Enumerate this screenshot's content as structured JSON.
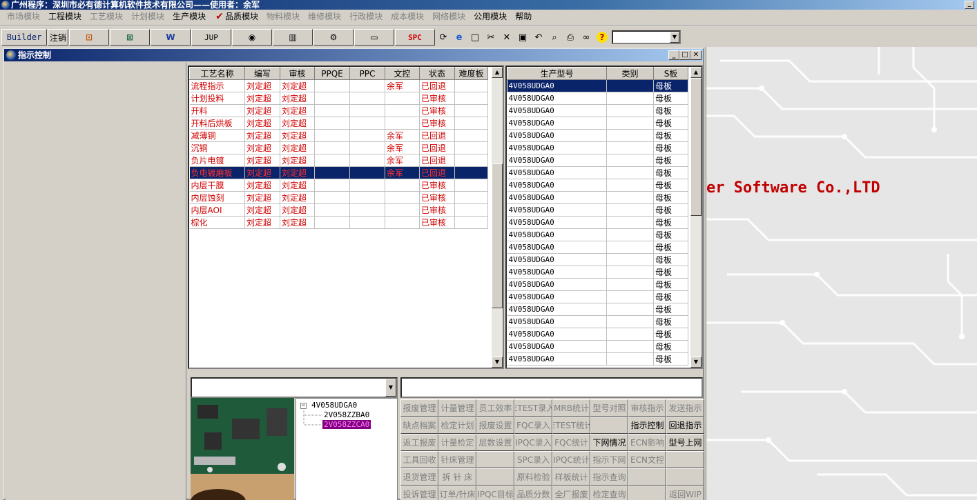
{
  "app": {
    "title": "广州程序：深圳市必有德计算机软件技术有限公司——使用者：余军"
  },
  "menu": [
    {
      "label": "市场模块",
      "enabled": false
    },
    {
      "label": "工程模块",
      "enabled": true
    },
    {
      "label": "工艺模块",
      "enabled": false
    },
    {
      "label": "计划模块",
      "enabled": false
    },
    {
      "label": "生产模块",
      "enabled": true
    },
    {
      "label": "品质模块",
      "enabled": true,
      "checked": true
    },
    {
      "label": "物料模块",
      "enabled": false
    },
    {
      "label": "维修模块",
      "enabled": false
    },
    {
      "label": "行政模块",
      "enabled": false
    },
    {
      "label": "成本模块",
      "enabled": false
    },
    {
      "label": "网络模块",
      "enabled": false
    },
    {
      "label": "公用模块",
      "enabled": true
    },
    {
      "label": "帮助",
      "enabled": true
    }
  ],
  "toolbar": {
    "builder": "Builder",
    "logout": "注销",
    "jup": "JUP",
    "spc": "SPC"
  },
  "desktop": {
    "splash": "er Software Co.,LTD"
  },
  "child": {
    "title": "指示控制"
  },
  "process_grid": {
    "columns": [
      "工艺名称",
      "编写",
      "审核",
      "PPQE",
      "PPC",
      "文控",
      "状态",
      "难度板"
    ],
    "rows": [
      [
        "流程指示",
        "刘定超",
        "刘定超",
        "",
        "",
        "余军",
        "已回退",
        ""
      ],
      [
        "计划投料",
        "刘定超",
        "刘定超",
        "",
        "",
        "",
        "已审核",
        ""
      ],
      [
        "开料",
        "刘定超",
        "刘定超",
        "",
        "",
        "",
        "已审核",
        ""
      ],
      [
        "开料后烘板",
        "刘定超",
        "刘定超",
        "",
        "",
        "",
        "已审核",
        ""
      ],
      [
        "减薄铜",
        "刘定超",
        "刘定超",
        "",
        "",
        "余军",
        "已回退",
        ""
      ],
      [
        "沉铜",
        "刘定超",
        "刘定超",
        "",
        "",
        "余军",
        "已回退",
        ""
      ],
      [
        "负片电镀",
        "刘定超",
        "刘定超",
        "",
        "",
        "余军",
        "已回退",
        ""
      ],
      [
        "负电镀磨板",
        "刘定超",
        "刘定超",
        "",
        "",
        "余军",
        "已回退",
        ""
      ],
      [
        "内层干膜",
        "刘定超",
        "刘定超",
        "",
        "",
        "",
        "已审核",
        ""
      ],
      [
        "内层蚀刻",
        "刘定超",
        "刘定超",
        "",
        "",
        "",
        "已审核",
        ""
      ],
      [
        "内层AOI",
        "刘定超",
        "刘定超",
        "",
        "",
        "",
        "已审核",
        ""
      ],
      [
        "棕化",
        "刘定超",
        "刘定超",
        "",
        "",
        "",
        "已审核",
        ""
      ]
    ],
    "selected_row": 7
  },
  "model_grid": {
    "columns": [
      "生产型号",
      "类别",
      "S板"
    ],
    "rows": [
      [
        "4V058UDGA0",
        "",
        "母板"
      ],
      [
        "4V058UDGA0",
        "",
        "母板"
      ],
      [
        "4V058UDGA0",
        "",
        "母板"
      ],
      [
        "4V058UDGA0",
        "",
        "母板"
      ],
      [
        "4V058UDGA0",
        "",
        "母板"
      ],
      [
        "4V058UDGA0",
        "",
        "母板"
      ],
      [
        "4V058UDGA0",
        "",
        "母板"
      ],
      [
        "4V058UDGA0",
        "",
        "母板"
      ],
      [
        "4V058UDGA0",
        "",
        "母板"
      ],
      [
        "4V058UDGA0",
        "",
        "母板"
      ],
      [
        "4V058UDGA0",
        "",
        "母板"
      ],
      [
        "4V058UDGA0",
        "",
        "母板"
      ],
      [
        "4V058UDGA0",
        "",
        "母板"
      ],
      [
        "4V058UDGA0",
        "",
        "母板"
      ],
      [
        "4V058UDGA0",
        "",
        "母板"
      ],
      [
        "4V058UDGA0",
        "",
        "母板"
      ],
      [
        "4V058UDGA0",
        "",
        "母板"
      ],
      [
        "4V058UDGA0",
        "",
        "母板"
      ],
      [
        "4V058UDGA0",
        "",
        "母板"
      ],
      [
        "4V058UDGA0",
        "",
        "母板"
      ],
      [
        "4V058UDGA0",
        "",
        "母板"
      ],
      [
        "4V058UDGA0",
        "",
        "母板"
      ],
      [
        "4V058UDGA0",
        "",
        "母板"
      ]
    ],
    "selected_row": 0
  },
  "tree": {
    "root": "4V058UDGA0",
    "children": [
      "2V058ZZBA0",
      "2V058ZZCA0"
    ],
    "selected_child": 1
  },
  "buttons": [
    {
      "label": "报废管理",
      "enabled": false
    },
    {
      "label": "计量管理",
      "enabled": false
    },
    {
      "label": "员工效率",
      "enabled": false
    },
    {
      "label": "ETEST录入",
      "enabled": false
    },
    {
      "label": "MRB统计",
      "enabled": false
    },
    {
      "label": "型号对照",
      "enabled": false
    },
    {
      "label": "审核指示",
      "enabled": false
    },
    {
      "label": "发送指示",
      "enabled": false
    },
    {
      "label": "缺点档案",
      "enabled": false
    },
    {
      "label": "检定计划",
      "enabled": false
    },
    {
      "label": "报废设置",
      "enabled": false
    },
    {
      "label": "FQC录入",
      "enabled": false
    },
    {
      "label": "ETEST统计",
      "enabled": false
    },
    {
      "label": "",
      "enabled": false
    },
    {
      "label": "指示控制",
      "enabled": true
    },
    {
      "label": "回退指示",
      "enabled": true
    },
    {
      "label": "返工报废",
      "enabled": false
    },
    {
      "label": "计量检定",
      "enabled": false
    },
    {
      "label": "层数设置",
      "enabled": false
    },
    {
      "label": "IPQC录入",
      "enabled": false
    },
    {
      "label": "FQC统计",
      "enabled": false
    },
    {
      "label": "下网情况",
      "enabled": true
    },
    {
      "label": "ECN影响",
      "enabled": false
    },
    {
      "label": "型号上网",
      "enabled": true
    },
    {
      "label": "工具回收",
      "enabled": false
    },
    {
      "label": "针床管理",
      "enabled": false
    },
    {
      "label": "",
      "enabled": false
    },
    {
      "label": "SPC录入",
      "enabled": false
    },
    {
      "label": "IPQC统计",
      "enabled": false
    },
    {
      "label": "指示下网",
      "enabled": false
    },
    {
      "label": "ECN文控",
      "enabled": false
    },
    {
      "label": "",
      "enabled": false
    },
    {
      "label": "退货管理",
      "enabled": false
    },
    {
      "label": "拆 针 床",
      "enabled": false
    },
    {
      "label": "",
      "enabled": false
    },
    {
      "label": "原料检验",
      "enabled": false
    },
    {
      "label": "样板统计",
      "enabled": false
    },
    {
      "label": "指示查询",
      "enabled": false
    },
    {
      "label": "",
      "enabled": false
    },
    {
      "label": "",
      "enabled": false
    },
    {
      "label": "投诉管理",
      "enabled": false
    },
    {
      "label": "订单/针床",
      "enabled": false
    },
    {
      "label": "IPQC目标",
      "enabled": false
    },
    {
      "label": "品质分数",
      "enabled": false
    },
    {
      "label": "全厂报废",
      "enabled": false
    },
    {
      "label": "检定查询",
      "enabled": false
    },
    {
      "label": "",
      "enabled": false
    },
    {
      "label": "返回WIP",
      "enabled": false
    }
  ],
  "colors": {
    "title_bar": "#0a246a",
    "selection": "#0a246a",
    "process_text": "#d00000",
    "splash_text": "#c00000",
    "face": "#d4d0c8"
  }
}
